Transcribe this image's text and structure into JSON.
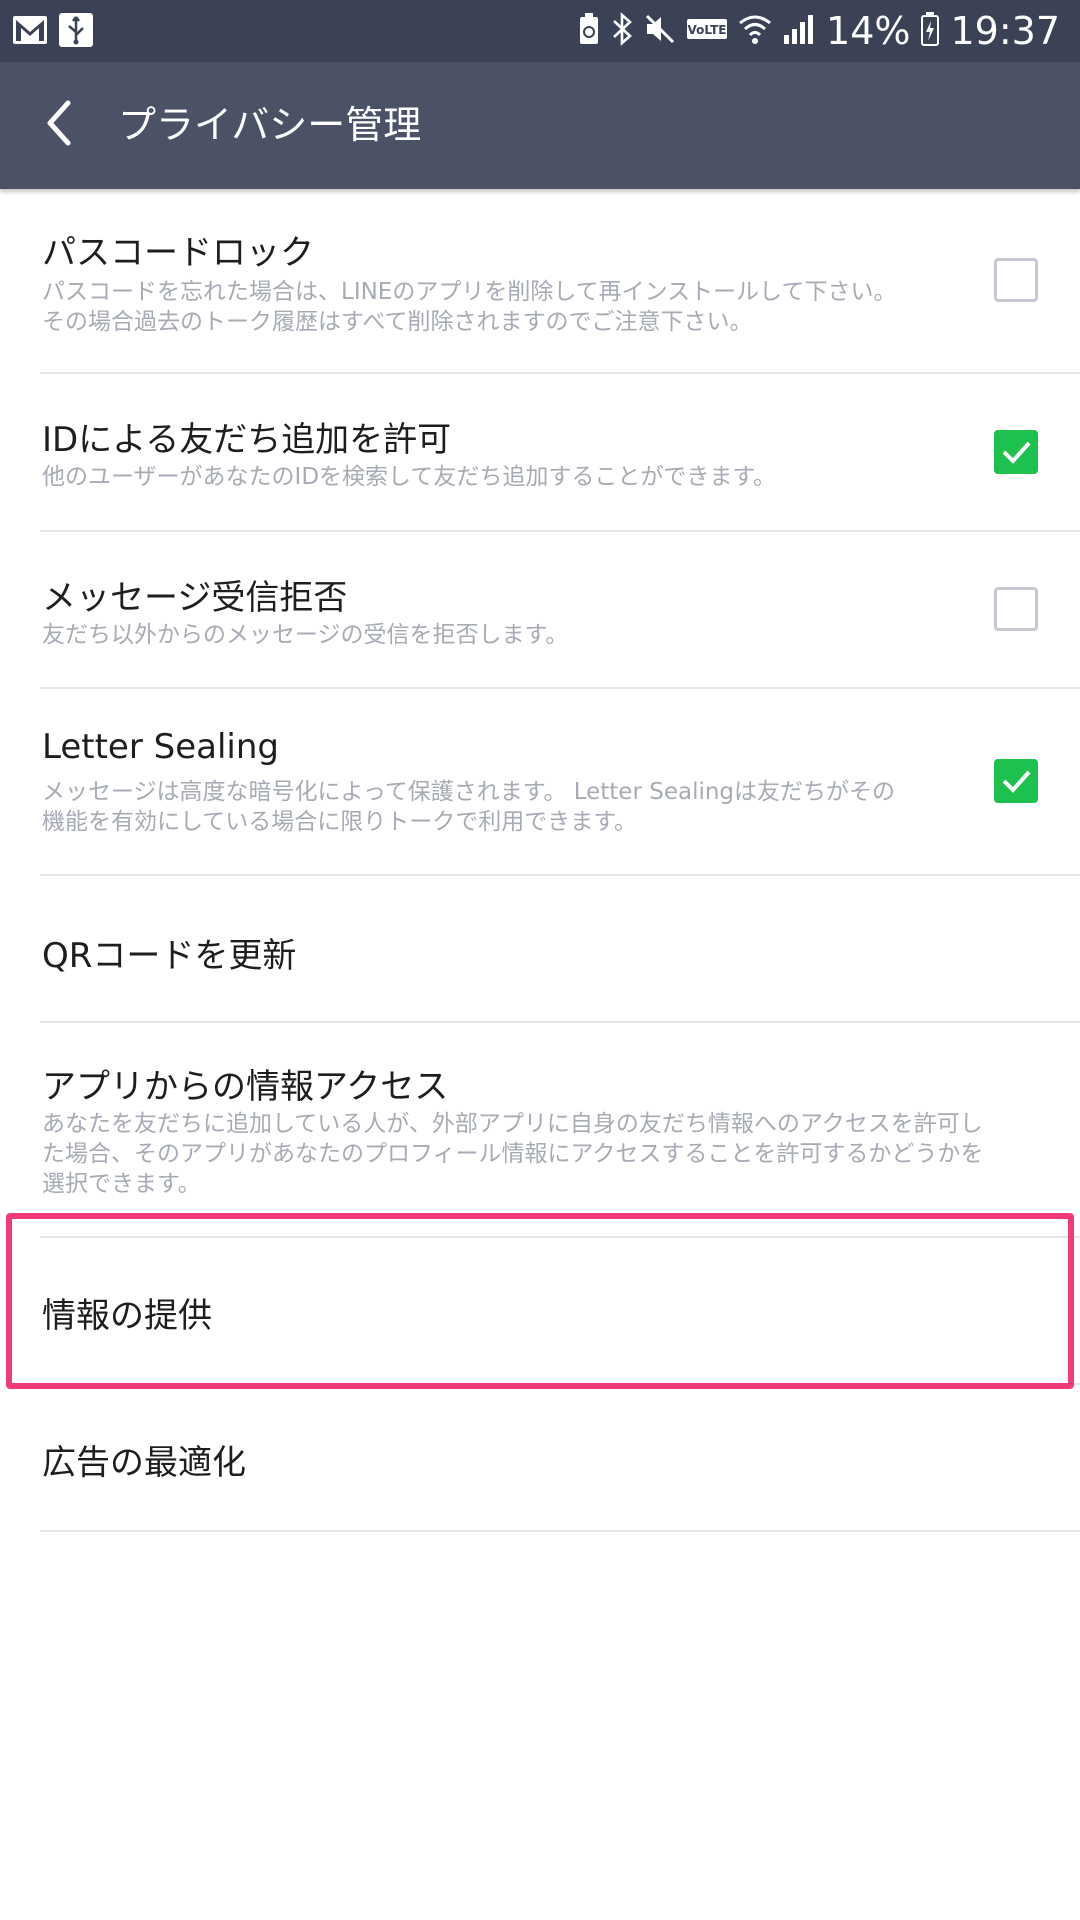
{
  "status_bar": {
    "battery": "14%",
    "time": "19:37",
    "icons": [
      "gmail-icon",
      "usb-icon",
      "battery-saver-icon",
      "bluetooth-icon",
      "mute-icon",
      "volte-icon",
      "wifi-icon",
      "signal-icon",
      "battery-icon"
    ]
  },
  "app_bar": {
    "title": "プライバシー管理",
    "back_icon": "chevron-left-icon"
  },
  "settings": [
    {
      "title": "パスコードロック",
      "description": "パスコードを忘れた場合は、LINEのアプリを削除して再インストールして下さい。\nその場合過去のトーク履歴はすべて削除されますのでご注意下さい。",
      "checked": false
    },
    {
      "title": "IDによる友だち追加を許可",
      "description": "他のユーザーがあなたのIDを検索して友だち追加することができます。",
      "checked": true
    },
    {
      "title": "メッセージ受信拒否",
      "description": "友だち以外からのメッセージの受信を拒否します。",
      "checked": false
    },
    {
      "title": "Letter Sealing",
      "description": "メッセージは高度な暗号化によって保護されます。 Letter Sealingは友だちがその\n機能を有効にしている場合に限りトークで利用できます。",
      "checked": true
    },
    {
      "title": "QRコードを更新"
    },
    {
      "title": "アプリからの情報アクセス",
      "description": "あなたを友だちに追加している人が、外部アプリに自身の友だち情報へのアクセスを許可し\nた場合、そのアプリがあなたのプロフィール情報にアクセスすることを許可するかどうかを\n選択できます。"
    },
    {
      "title": "情報の提供"
    },
    {
      "title": "広告の最適化"
    }
  ],
  "colors": {
    "status_bar": "#3b4256",
    "app_bar": "#4b5266",
    "checkbox_on": "#1ec14d",
    "highlight": "#f03b78"
  }
}
